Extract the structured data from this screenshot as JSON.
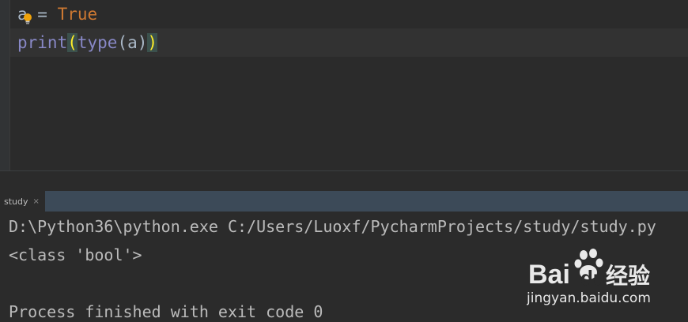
{
  "editor": {
    "line1": {
      "var": "a",
      "op": " = ",
      "value": "True"
    },
    "line2": {
      "fn": "print",
      "open_paren": "(",
      "inner_fn": "type",
      "inner_args": "(a)",
      "close_paren": ")"
    }
  },
  "run_panel": {
    "tab_label": "study",
    "close_symbol": "×",
    "output": [
      "D:\\Python36\\python.exe C:/Users/Luoxf/PycharmProjects/study/study.py",
      "<class 'bool'>",
      "Process finished with exit code 0"
    ]
  },
  "watermark": {
    "brand_left": "Bai",
    "brand_right": "du",
    "brand_cn": "经验",
    "url": "jingyan.baidu.com"
  },
  "colors": {
    "editor_bg": "#2b2b2b",
    "keyword": "#cc7832",
    "builtin": "#8888c6",
    "paren_highlight": "#ffef28",
    "tab_strip": "#3c4a58",
    "console_text": "#bbbbbb"
  },
  "icons": {
    "intention": "lightbulb-icon",
    "close": "close-icon"
  }
}
